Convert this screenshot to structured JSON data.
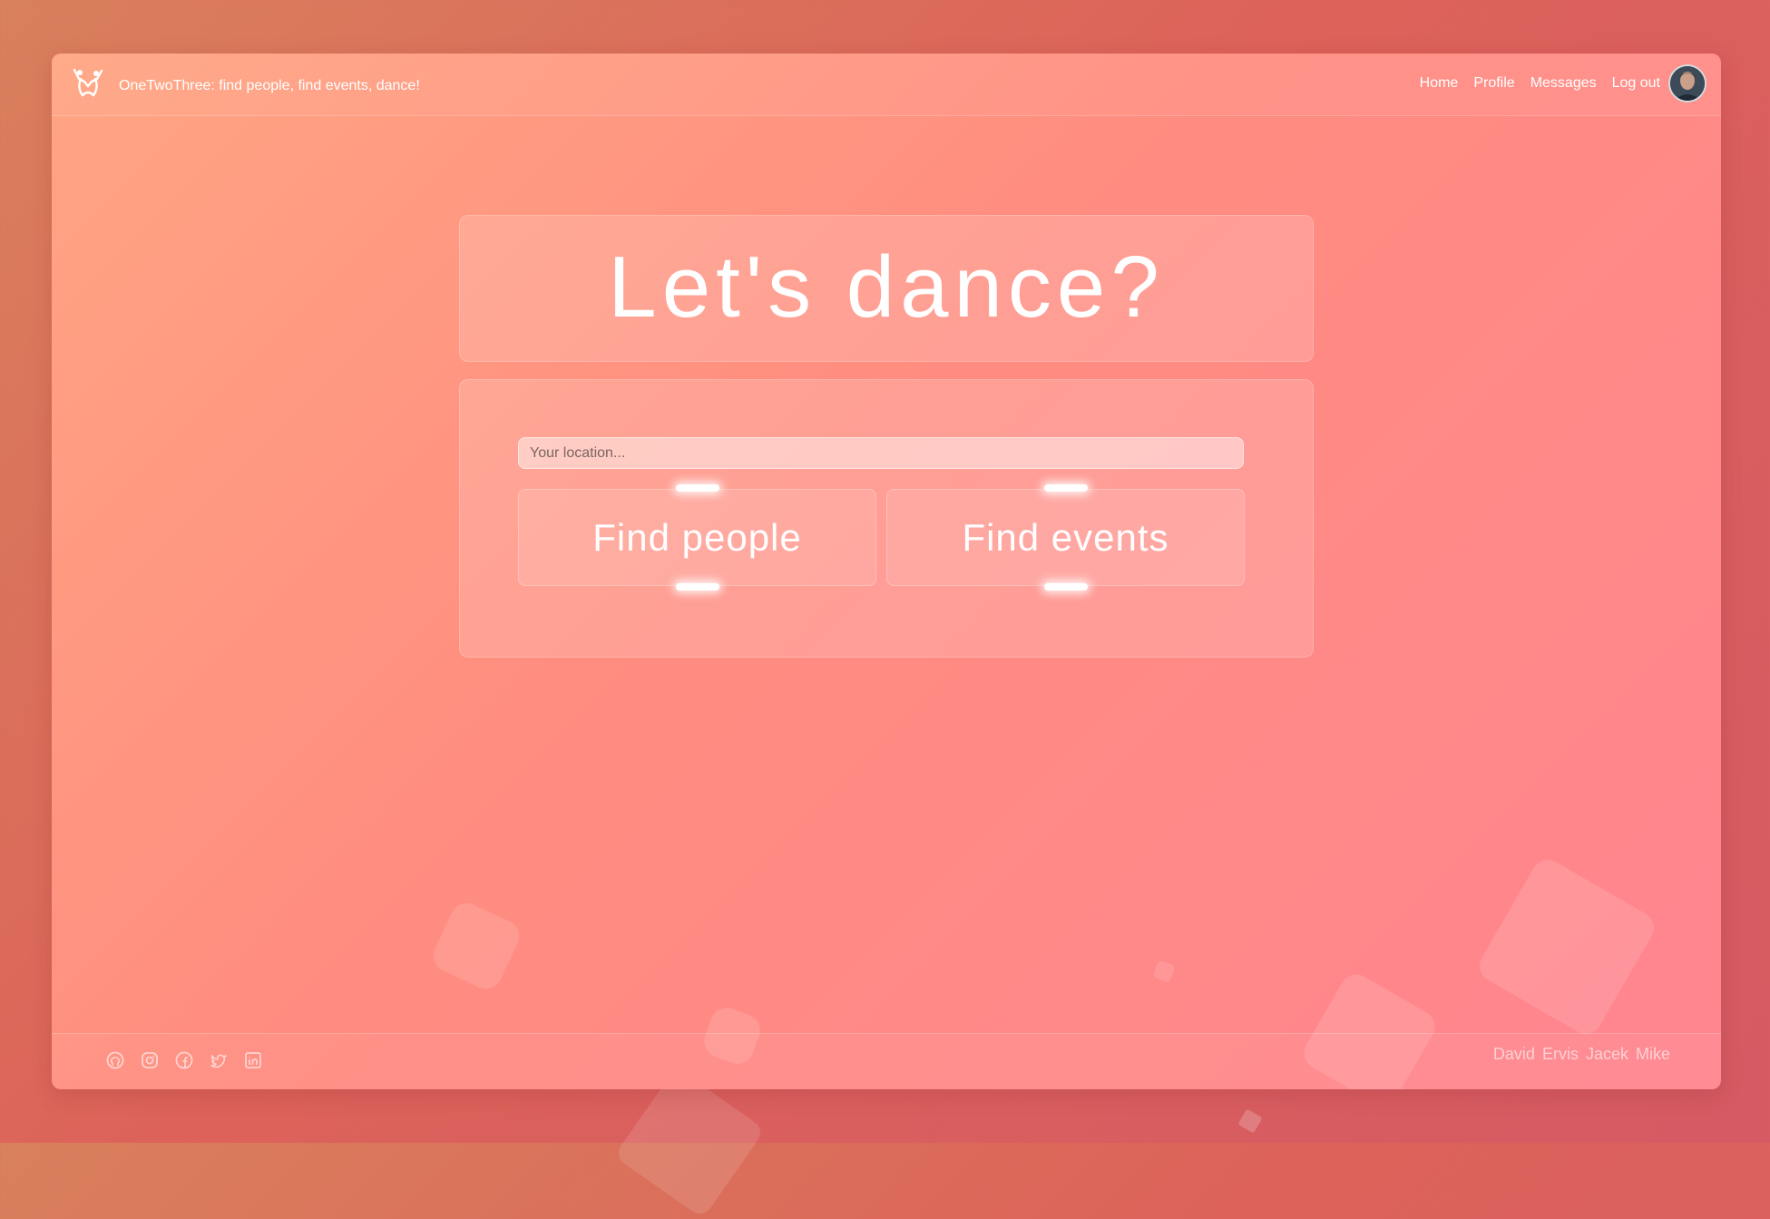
{
  "header": {
    "brand": "OneTwoThree: find people, find events, dance!",
    "nav": [
      "Home",
      "Profile",
      "Messages",
      "Log out"
    ]
  },
  "hero": {
    "title": "Let's dance?"
  },
  "search": {
    "placeholder": "Your location...",
    "find_people_label": "Find people",
    "find_events_label": "Find events"
  },
  "footer": {
    "social_icons": [
      "github-icon",
      "instagram-icon",
      "facebook-icon",
      "twitter-icon",
      "linkedin-icon"
    ],
    "authors": [
      "David",
      "Ervis",
      "Jacek",
      "Mike"
    ]
  },
  "colors": {
    "page_background": "#dc625a",
    "app_gradient_start": "#ffa582",
    "app_gradient_end": "#ff8590",
    "text": "#ffffff"
  }
}
